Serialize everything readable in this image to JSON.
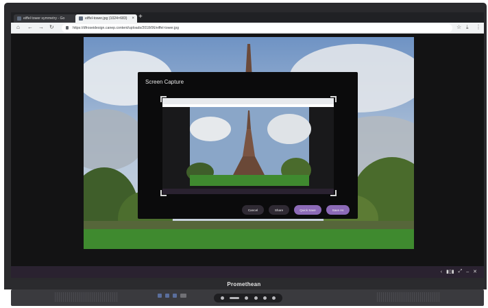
{
  "browser": {
    "tabs": [
      {
        "title": "eiffel tower symmetry - Go"
      },
      {
        "title": "eiffel-tower.jpg (1024×683)"
      }
    ],
    "address_url": "https://dfroseidesign.canep.content/uploads/2018/06/eiffel-tower.jpg",
    "new_tab_symbol": "+",
    "close_symbol": "×"
  },
  "dialog": {
    "title": "Screen Capture",
    "buttons": {
      "cancel": "Cancel",
      "share": "Share",
      "quick_save": "Quick Save",
      "save_as": "Save As"
    }
  },
  "device": {
    "brand": "Promethean"
  },
  "colors": {
    "accent_purple": "#8c6ab7",
    "button_dark": "#2f2a33",
    "sky": "#7fa3cf",
    "grass": "#3f8a2f"
  },
  "icons": [
    "home-icon",
    "back-icon",
    "forward-icon",
    "reload-icon",
    "lock-icon",
    "star-icon",
    "download-icon",
    "menu-icon",
    "chevron-left-icon",
    "split-icon",
    "fullscreen-icon",
    "minimize-icon",
    "close-icon"
  ]
}
